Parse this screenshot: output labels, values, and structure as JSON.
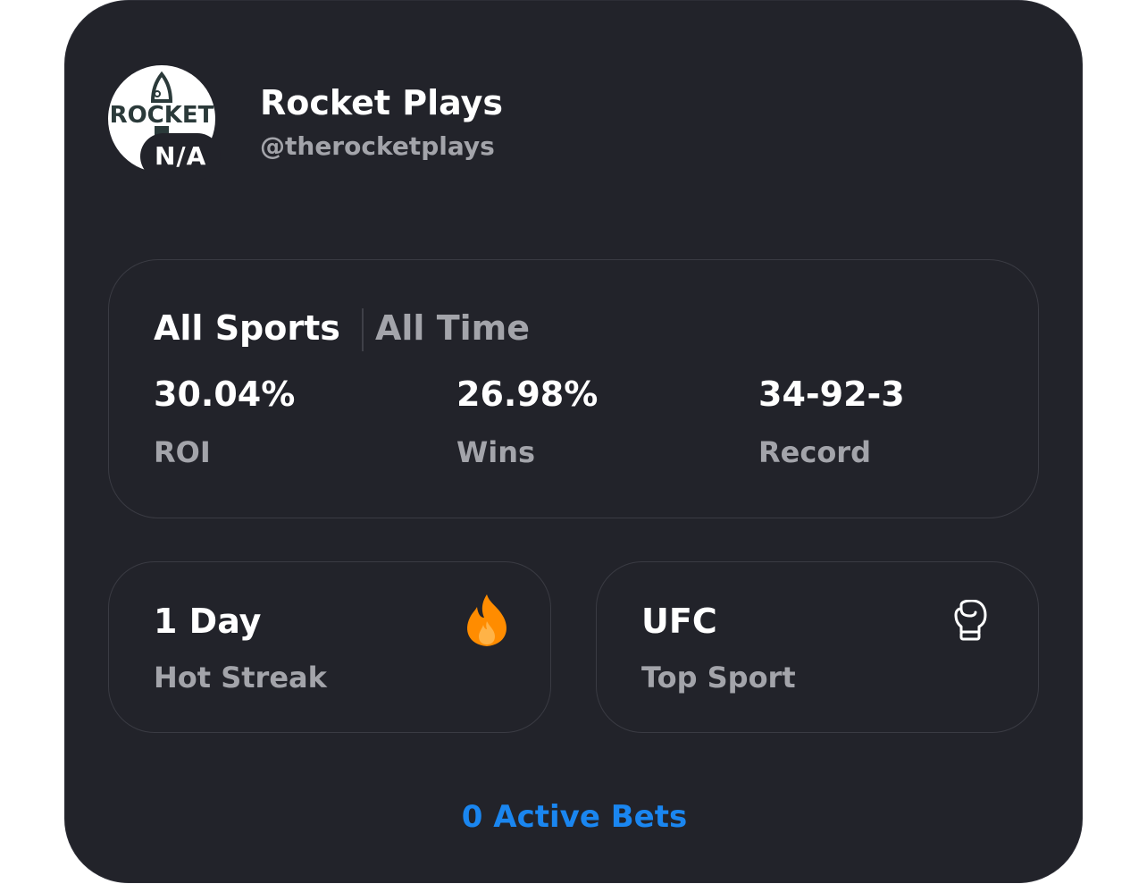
{
  "profile": {
    "avatar_text": "ROCKET",
    "badge": "N/A",
    "name": "Rocket Plays",
    "handle": "@therocketplays"
  },
  "filters": {
    "sport": "All Sports",
    "time": "All Time"
  },
  "stats": [
    {
      "value": "30.04%",
      "label": "ROI"
    },
    {
      "value": "26.98%",
      "label": "Wins"
    },
    {
      "value": "34-92-3",
      "label": "Record"
    }
  ],
  "streak": {
    "value": "1 Day",
    "label": "Hot Streak",
    "icon": "fire-icon",
    "icon_color": "#ff8c00"
  },
  "top_sport": {
    "value": "UFC",
    "label": "Top Sport",
    "icon": "boxing-glove-icon"
  },
  "footer": {
    "active_bets": "0 Active Bets",
    "link_color": "#1a86f0"
  }
}
